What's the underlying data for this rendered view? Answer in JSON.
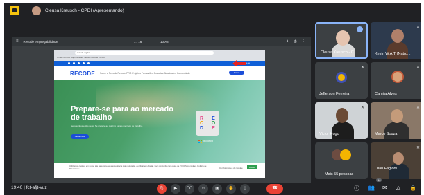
{
  "topbar": {
    "presenter_label": "Cleusa Kreusch - CPDI (Apresentando)"
  },
  "document_toolbar": {
    "file_name": "Recode empregabilidade",
    "page_indicator": "1 / 16",
    "zoom": "100%"
  },
  "slide": {
    "browser": {
      "url": "recode.org.br",
      "bookmarks": "Gmail   YouTube   Maps   Notícias   Tradutor   Recode   Cursos"
    },
    "site": {
      "top_links": "Login   Inscreva-se",
      "logo": "RECODE",
      "nav_links": "Sobre a Recode    Recode PRO    Projetos    Formações Gratuitas    Atualidades    Comunidade",
      "nav_button": "Entrar",
      "hero_title": "Prepare-se para ao mercado de trabalho",
      "hero_subtitle": "Seus sonhos estão perto! Se prepare ao máximo para o mercado de trabalho.",
      "cta_label": "Saiba mais",
      "card_letters": [
        "R",
        "E",
        "C",
        "O",
        "D",
        "E"
      ],
      "partner": "Microsoft",
      "cookie_text": "Utilizamos cookies em nosso site para fornecer a experiência mais relevante. Ao clicar em Aceitar, você concorda com o uso de TODOS os cookies. Política de Privacidade.",
      "cookie_settings": "Configurações de Cookie",
      "cookie_accept": "Aceito"
    }
  },
  "participants": [
    {
      "name": "Cleusa Kreusch - C...",
      "active": true
    },
    {
      "name": "Kevin W.A.T (Natro..."
    },
    {
      "name": "Jefferson Ferreira"
    },
    {
      "name": "Camila Alves"
    },
    {
      "name": "Victor Hugo"
    },
    {
      "name": "Marco Souza"
    },
    {
      "name": "Mais 55 pessoas"
    },
    {
      "name": "Luan Fagioni"
    }
  ],
  "bottombar": {
    "time": "19:40",
    "meeting_code": "fct-afjt-vuz",
    "people_badge": "64"
  },
  "colors": {
    "background": "#202124",
    "tile": "#3c4043",
    "end_call": "#ea4335",
    "accent": "#8ab4f8"
  }
}
